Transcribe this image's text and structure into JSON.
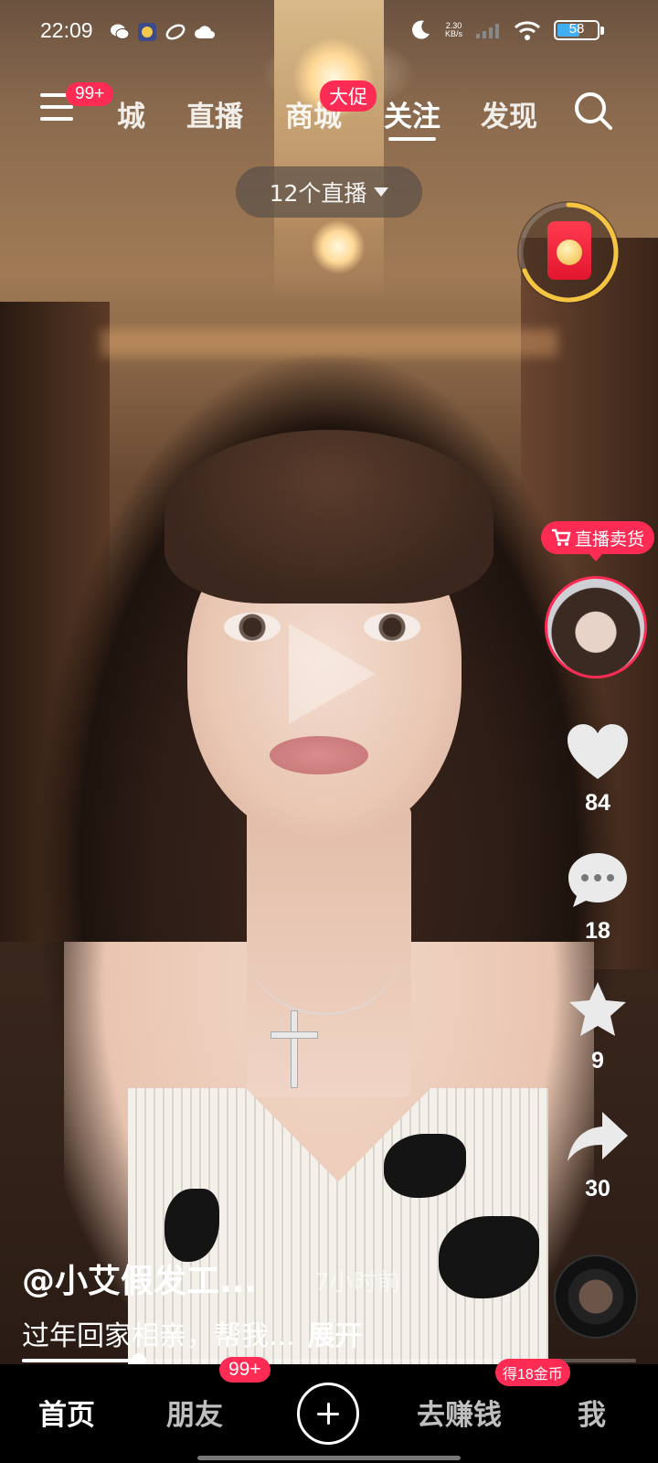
{
  "status_bar": {
    "time": "22:09",
    "net_speed_value": "2.30",
    "net_speed_unit": "KB/s",
    "battery_level": 58,
    "battery_label": "58"
  },
  "top_nav": {
    "menu_badge": "99+",
    "tabs": [
      "城",
      "直播",
      "商城",
      "关注",
      "发现"
    ],
    "active_tab": "关注",
    "mall_badge": "大促"
  },
  "live_pill": {
    "label": "12个直播"
  },
  "right_rail": {
    "sell_tag": "直播卖货",
    "like_count": "84",
    "comment_count": "18",
    "favorite_count": "9",
    "share_count": "30"
  },
  "caption": {
    "username": "@小艾假发工...",
    "time_ago": "7小时前",
    "text": "过年回家相亲，帮我...",
    "more_label": "展开"
  },
  "video_progress": 0.19,
  "bottom_nav": {
    "items": [
      "首页",
      "朋友",
      "去赚钱",
      "我"
    ],
    "active": "首页",
    "friends_badge": "99+",
    "earn_badge": "得18金币"
  },
  "colors": {
    "accent": "#fe2c55",
    "battery_fill": "#43aeef",
    "red_packet_ring": "#f5c542"
  },
  "icons": [
    "menu-icon",
    "search-icon",
    "caret-down-icon",
    "red-packet-icon",
    "cart-icon",
    "heart-icon",
    "comment-icon",
    "star-icon",
    "share-icon",
    "plus-icon",
    "play-icon",
    "music-disc-icon",
    "wifi-icon",
    "signal-icon",
    "moon-icon",
    "wechat-icon",
    "cloud-icon"
  ]
}
